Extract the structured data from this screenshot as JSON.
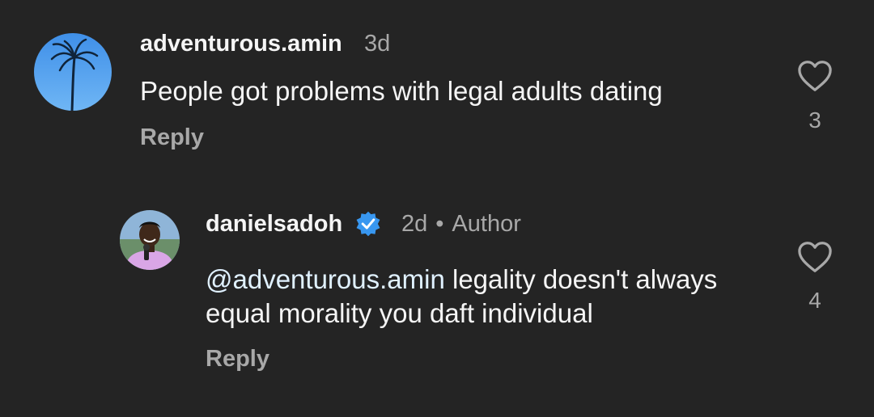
{
  "comments": [
    {
      "username": "adventurous.amin",
      "time": "3d",
      "text": "People got problems with legal adults dating",
      "reply_label": "Reply",
      "likes": "3",
      "avatar": "palm-tree-sky",
      "like_icon": "heart-outline-icon"
    },
    {
      "username": "danielsadoh",
      "verified": true,
      "time": "2d",
      "separator": "•",
      "role": "Author",
      "mention": "@adventurous.amin",
      "text": " legality doesn't always equal morality you daft individual",
      "reply_label": "Reply",
      "likes": "4",
      "avatar": "person-with-microphone",
      "like_icon": "heart-outline-icon"
    }
  ],
  "colors": {
    "background": "#242424",
    "primary_text": "#f5f5f5",
    "secondary_text": "#a8a8a8",
    "verified_badge": "#3897f0",
    "mention": "#e0f1ff"
  }
}
